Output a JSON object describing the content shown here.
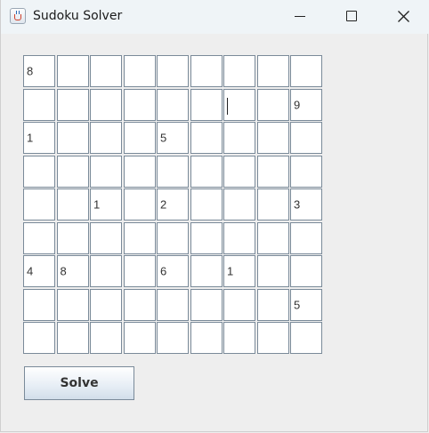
{
  "window": {
    "title": "Sudoku Solver",
    "controls": [
      "minimize",
      "maximize",
      "close"
    ]
  },
  "icons": {
    "app": "java-cup-icon",
    "minimize": "minimize-icon",
    "maximize": "maximize-icon",
    "close": "close-icon"
  },
  "grid": {
    "rows": [
      [
        "8",
        "",
        "",
        "",
        "",
        "",
        "",
        "",
        ""
      ],
      [
        "",
        "",
        "",
        "",
        "",
        "",
        "",
        "",
        "9"
      ],
      [
        "1",
        "",
        "",
        "",
        "5",
        "",
        "",
        "",
        ""
      ],
      [
        "",
        "",
        "",
        "",
        "",
        "",
        "",
        "",
        ""
      ],
      [
        "",
        "",
        "1",
        "",
        "2",
        "",
        "",
        "",
        "3"
      ],
      [
        "",
        "",
        "",
        "",
        "",
        "",
        "",
        "",
        ""
      ],
      [
        "4",
        "8",
        "",
        "",
        "6",
        "",
        "1",
        "",
        ""
      ],
      [
        "",
        "",
        "",
        "",
        "",
        "",
        "",
        "",
        "5"
      ],
      [
        "",
        "",
        "",
        "",
        "",
        "",
        "",
        "",
        ""
      ]
    ],
    "focused_cell": {
      "row": 1,
      "col": 6
    }
  },
  "solve_button": {
    "label": "Solve"
  },
  "colors": {
    "window_bg": "#eeeeee",
    "titlebar_bg": "#eff4f7",
    "cell_border": "#7a8a99",
    "cell_bg": "#ffffff"
  }
}
